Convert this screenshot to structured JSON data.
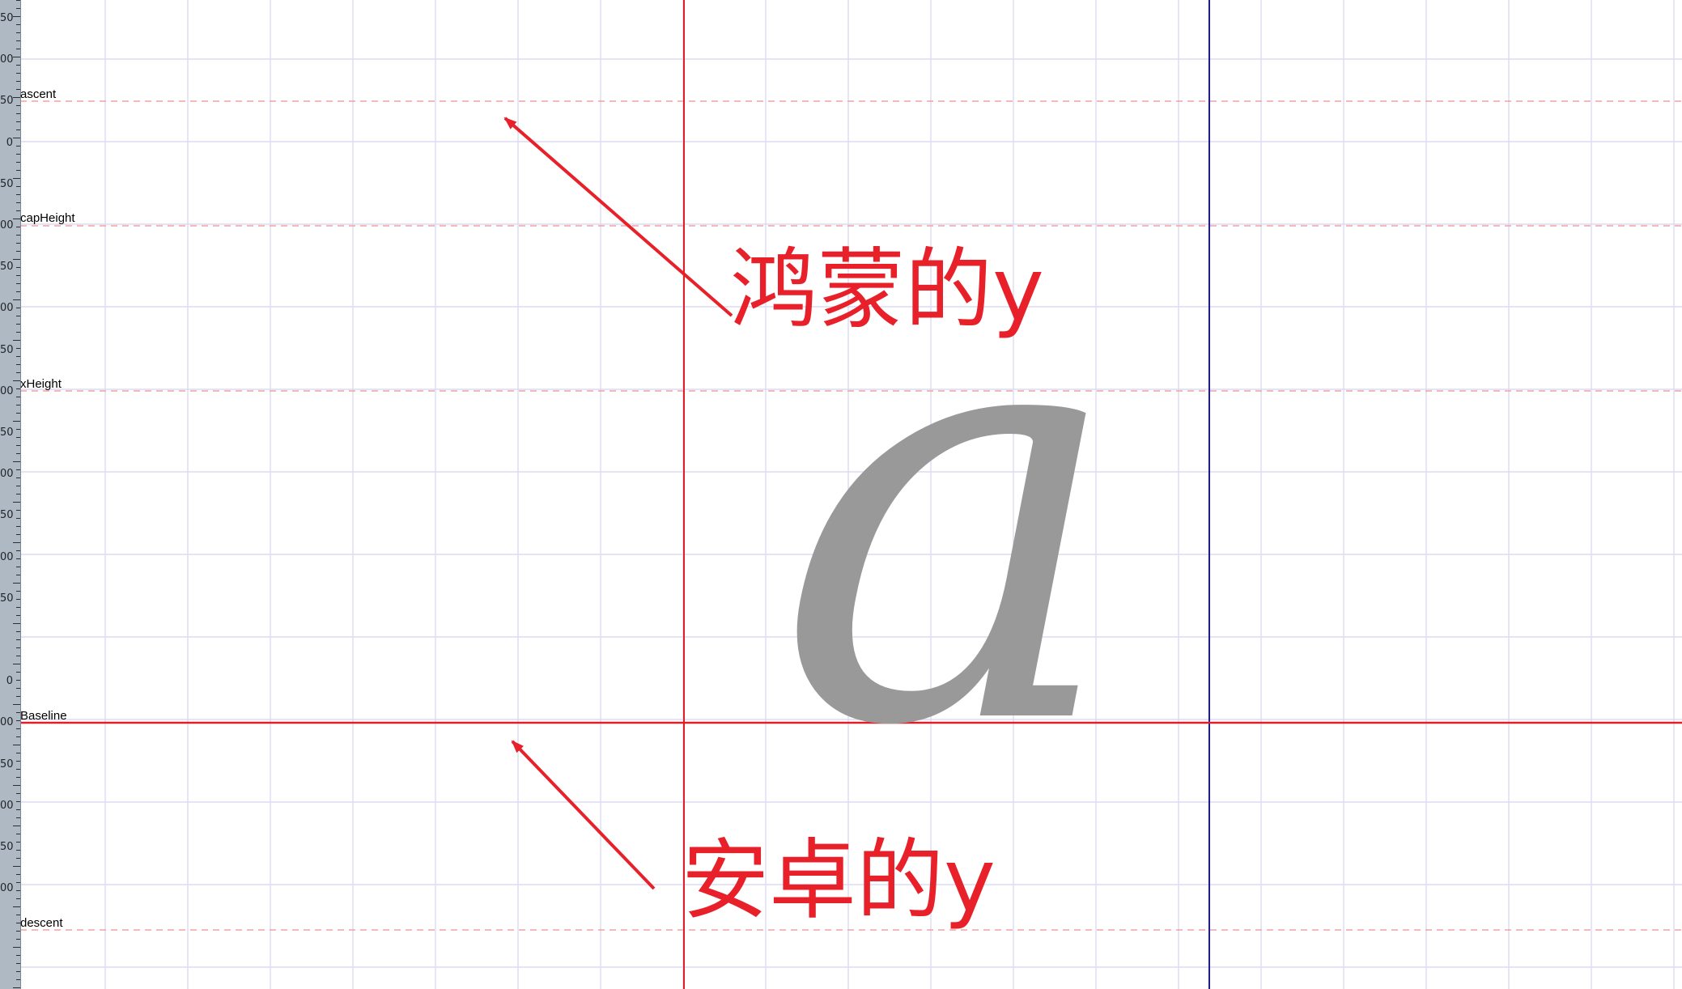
{
  "metrics": {
    "ascent": "ascent",
    "capHeight": "capHeight",
    "xHeight": "xHeight",
    "baseline": "Baseline",
    "descent": "descent"
  },
  "glyph": {
    "char": "a",
    "color": "#999999"
  },
  "annotations": {
    "harmony_y": "鸿蒙的y",
    "android_y": "安卓的y"
  },
  "ruler": {
    "labels": [
      "50",
      "00",
      "50",
      "0",
      "50",
      "00",
      "50",
      "00",
      "50",
      "00",
      "50",
      "00",
      "50",
      "00",
      "50",
      "",
      "0",
      "00",
      "50",
      "00",
      "50",
      "00"
    ]
  },
  "colors": {
    "grid": "#dcdcf2",
    "baseline": "#e01e25",
    "dashed_metric": "#f2a2a2",
    "origin_vertical": "#e01e25",
    "advance_vertical": "#1a1ab0",
    "annotation": "#e8202a",
    "ruler_bg": "#aeb9c4"
  }
}
